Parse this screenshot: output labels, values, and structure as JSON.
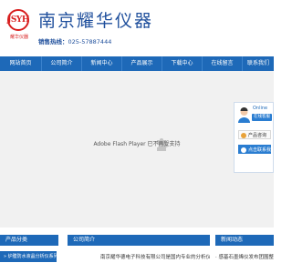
{
  "header": {
    "logo_text": "JSYH",
    "logo_sub": "耀华仪器",
    "company_name": "南京耀华仪器",
    "hotline_label": "销售热线：",
    "hotline_number": "025-57887444"
  },
  "nav": {
    "items": [
      {
        "label": "网站首页"
      },
      {
        "label": "公司简介"
      },
      {
        "label": "新闻中心"
      },
      {
        "label": "产品展示"
      },
      {
        "label": "下载中心"
      },
      {
        "label": "在线留言"
      },
      {
        "label": "联系我们"
      }
    ]
  },
  "banner": {
    "flash_message": "Adobe Flash Player 已不再受支持"
  },
  "customer_service": {
    "tag": "Online",
    "online_label": "在线客服",
    "sales_label": "产品咨询",
    "contact_label": "点击联系我"
  },
  "sections": {
    "products_title": "产品分类",
    "products_item": "» 炉膛防水液晶分析仪系列",
    "about_title": "公司简介",
    "about_text": "南京耀华德电子科技有限公司是国内专业的分析仪器专业厂",
    "news_title": "新闻动态",
    "news_text": "· 感基石墨烯仪发布团围整测仪"
  },
  "colors": {
    "brand_blue": "#1e69b8",
    "logo_red": "#d81e1e",
    "banner_bg": "#f1f1f1"
  }
}
